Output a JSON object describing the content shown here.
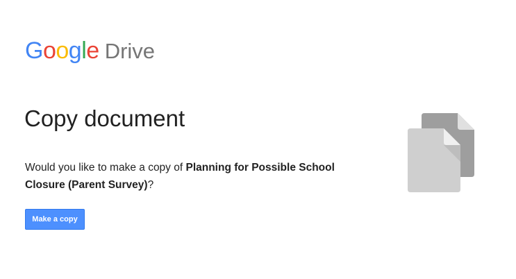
{
  "brand": {
    "logo_letters": [
      {
        "char": "G",
        "color": "#4285F4"
      },
      {
        "char": "o",
        "color": "#EA4335"
      },
      {
        "char": "o",
        "color": "#FBBC05"
      },
      {
        "char": "g",
        "color": "#4285F4"
      },
      {
        "char": "l",
        "color": "#34A853"
      },
      {
        "char": "e",
        "color": "#EA4335"
      }
    ],
    "product": "Drive"
  },
  "dialog": {
    "title": "Copy document",
    "prompt_prefix": "Would you like to make a copy of ",
    "document_name": "Planning for Possible School Closure (Parent Survey)",
    "prompt_suffix": "?",
    "make_copy_label": "Make a copy"
  },
  "illustration": {
    "icon": "copy-documents-icon",
    "back_color": "#9e9e9e",
    "front_color": "#cfcfcf"
  },
  "colors": {
    "button_bg": "#4d90fe",
    "button_border": "#3079ed"
  }
}
